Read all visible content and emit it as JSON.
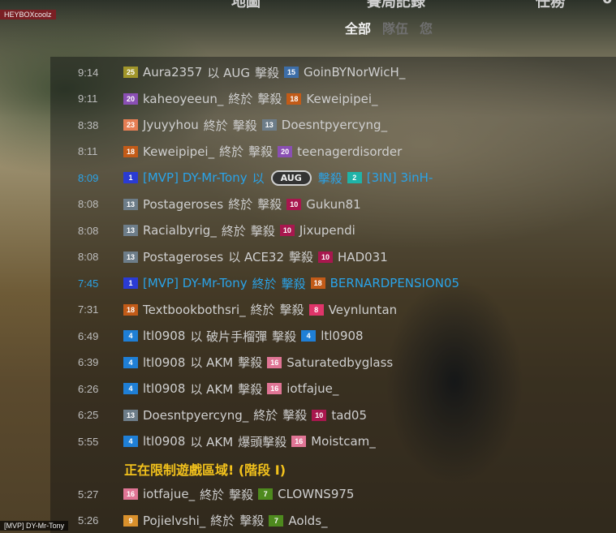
{
  "watermark": "HEYBOXcoolz",
  "footer_label": "[MVP] DY-Mr-Tony",
  "top_nav": {
    "left": "地圖",
    "center": "賽局記錄",
    "right": "任務",
    "extra": "0"
  },
  "subtabs": [
    "全部",
    "隊伍",
    "您"
  ],
  "rows": [
    {
      "time": "9:14",
      "b1": "25",
      "c1": "#a1962a",
      "n1": "Aura2357",
      "verb": "以 AUG",
      "act": "擊殺",
      "b2": "15",
      "c2": "#3d6ea8",
      "n2": "GoinBYNorWicH_"
    },
    {
      "time": "9:11",
      "b1": "20",
      "c1": "#8a4fb3",
      "n1": "kaheoyeeun_",
      "verb": "終於",
      "act": "擊殺",
      "b2": "18",
      "c2": "#c25b18",
      "n2": "Keweipipei_"
    },
    {
      "time": "8:38",
      "b1": "23",
      "c1": "#e67e54",
      "n1": "Jyuyyhou",
      "verb": "終於",
      "act": "擊殺",
      "b2": "13",
      "c2": "#6d7d89",
      "n2": "Doesntpyercyng_"
    },
    {
      "time": "8:11",
      "b1": "18",
      "c1": "#c25b18",
      "n1": "Keweipipei_",
      "verb": "終於",
      "act": "擊殺",
      "b2": "20",
      "c2": "#8a4fb3",
      "n2": "teenagerdisorder"
    },
    {
      "time": "7:31",
      "b1": "18",
      "c1": "#c25b18",
      "n1": "Textbookbothsri_",
      "verb": "終於",
      "act": "擊殺",
      "b2": "8",
      "c2": "#e0356a",
      "n2": "Veynluntan"
    },
    {
      "time": "6:49",
      "b1": "4",
      "c1": "#1f7fd6",
      "n1": "ltl0908",
      "verb": "以 破片手榴彈",
      "act": "擊殺",
      "b2": "4",
      "c2": "#1f7fd6",
      "n2": "ltl0908"
    },
    {
      "time": "6:39",
      "b1": "4",
      "c1": "#1f7fd6",
      "n1": "ltl0908",
      "verb": "以 AKM",
      "act": "擊殺",
      "b2": "16",
      "c2": "#e07595",
      "n2": "Saturatedbyglass"
    },
    {
      "time": "6:26",
      "b1": "4",
      "c1": "#1f7fd6",
      "n1": "ltl0908",
      "verb": "以 AKM",
      "act": "擊殺",
      "b2": "16",
      "c2": "#e07595",
      "n2": "iotfajue_"
    },
    {
      "time": "6:25",
      "b1": "13",
      "c1": "#6d7d89",
      "n1": "Doesntpyercyng_",
      "verb": "終於",
      "act": "擊殺",
      "b2": "10",
      "c2": "#a8174e",
      "n2": "tad05"
    },
    {
      "time": "5:55",
      "b1": "4",
      "c1": "#1f7fd6",
      "n1": "ltl0908",
      "verb": "以 AKM",
      "act": "爆頭擊殺",
      "b2": "16",
      "c2": "#e07595",
      "n2": "Moistcam_"
    },
    {
      "time": "5:27",
      "b1": "16",
      "c1": "#e07595",
      "n1": "iotfajue_",
      "verb": "終於",
      "act": "擊殺",
      "b2": "7",
      "c2": "#4e8a1e",
      "n2": "CLOWNS975"
    },
    {
      "time": "5:26",
      "b1": "9",
      "c1": "#d9902c",
      "n1": "Pojielvshi_",
      "verb": "終於",
      "act": "擊殺",
      "b2": "7",
      "c2": "#4e8a1e",
      "n2": "Aolds_"
    }
  ],
  "mvp_rows": [
    {
      "time": "8:09",
      "b1": "1",
      "c1": "#2a3bd4",
      "n1": "[MVP] DY-Mr-Tony",
      "verb": "以",
      "weapon": "AUG",
      "act": "擊殺",
      "b2": "2",
      "c2": "#1fb3a8",
      "n2": "[3IN] 3inH-"
    },
    {
      "time": "7:45",
      "b1": "1",
      "c1": "#2a3bd4",
      "n1": "[MVP] DY-Mr-Tony",
      "verb": "終於",
      "act": "擊殺",
      "b2": "18",
      "c2": "#c25b18",
      "n2": "BERNARDPENSION05"
    }
  ],
  "plain_rows": [
    {
      "time": "8:08",
      "b1": "13",
      "c1": "#6d7d89",
      "n1": "Postageroses",
      "verb": "終於",
      "act": "擊殺",
      "b2": "10",
      "c2": "#a8174e",
      "n2": "Gukun81"
    },
    {
      "time": "8:08",
      "b1": "13",
      "c1": "#6d7d89",
      "n1": "Racialbyrig_",
      "verb": "終於",
      "act": "擊殺",
      "b2": "10",
      "c2": "#a8174e",
      "n2": "Jixupendi"
    },
    {
      "time": "8:08",
      "b1": "13",
      "c1": "#6d7d89",
      "n1": "Postageroses",
      "verb": "以 ACE32",
      "act": "擊殺",
      "b2": "10",
      "c2": "#a8174e",
      "n2": "HAD031"
    }
  ],
  "warning": "正在限制遊戲區域! (階段 I)"
}
